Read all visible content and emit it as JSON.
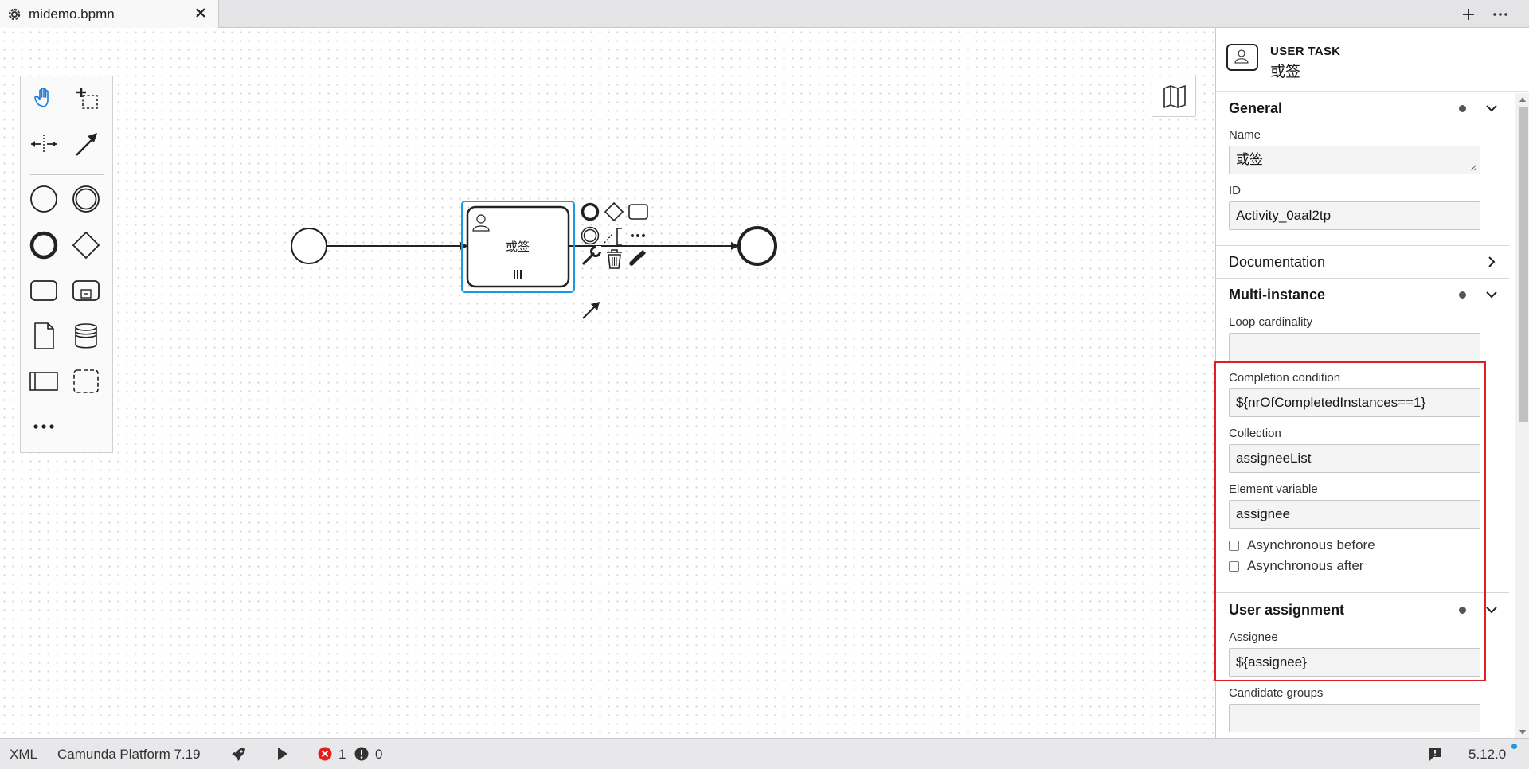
{
  "tab": {
    "title": "midemo.bpmn"
  },
  "diagram": {
    "task_name": "或签"
  },
  "properties": {
    "element_type": "USER TASK",
    "element_name": "或签",
    "groups": {
      "general": "General",
      "documentation": "Documentation",
      "multi_instance": "Multi-instance",
      "user_assignment": "User assignment"
    },
    "fields": {
      "name_label": "Name",
      "name_value": "或签",
      "id_label": "ID",
      "id_value": "Activity_0aal2tp",
      "loop_cardinality_label": "Loop cardinality",
      "loop_cardinality_value": "",
      "completion_condition_label": "Completion condition",
      "completion_condition_value": "${nrOfCompletedInstances==1}",
      "collection_label": "Collection",
      "collection_value": "assigneeList",
      "element_variable_label": "Element variable",
      "element_variable_value": "assignee",
      "async_before_label": "Asynchronous before",
      "async_after_label": "Asynchronous after",
      "assignee_label": "Assignee",
      "assignee_value": "${assignee}",
      "candidate_groups_label": "Candidate groups",
      "candidate_groups_value": ""
    }
  },
  "status": {
    "xml": "XML",
    "platform": "Camunda Platform 7.19",
    "errors": "1",
    "warnings": "0",
    "version": "5.12.0"
  },
  "colors": {
    "selection": "#1a9ae0",
    "highlight": "#e02020",
    "error": "#e02020",
    "accent": "#1a9ae0"
  },
  "icons": [
    "gear-icon",
    "close-icon",
    "plus-icon",
    "more-icon",
    "hand-tool-icon",
    "lasso-tool-icon",
    "space-tool-icon",
    "connect-tool-icon",
    "map-icon",
    "rocket-icon",
    "play-icon",
    "feedback-icon"
  ]
}
